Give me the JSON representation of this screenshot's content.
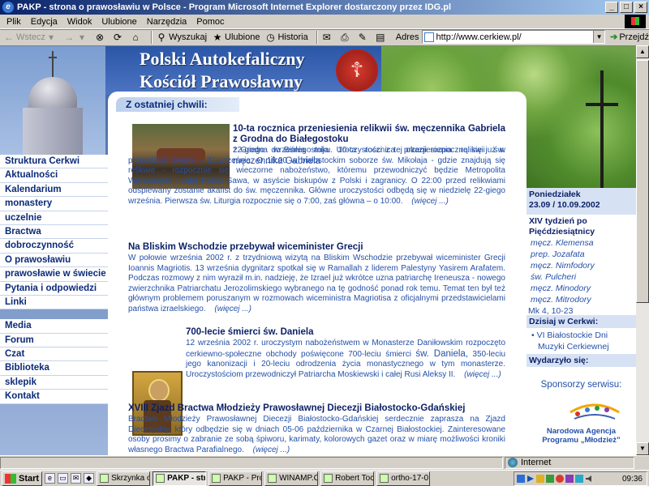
{
  "window": {
    "title": "PAKP - strona o prawosławiu w Polsce - Program Microsoft Internet Explorer dostarczony przez IDG.pl",
    "minimize": "_",
    "maximize": "□",
    "close": "×"
  },
  "menu": [
    "Plik",
    "Edycja",
    "Widok",
    "Ulubione",
    "Narzędzia",
    "Pomoc"
  ],
  "toolbar": {
    "back": "Wstecz",
    "search": "Wyszukaj",
    "favorites": "Ulubione",
    "history": "Historia",
    "address_label": "Adres",
    "address_value": "http://www.cerkiew.pl/",
    "go": "Przejdź"
  },
  "site": {
    "title_line1": "Polski Autokefaliczny",
    "title_line2": "Kościół Prawosławny",
    "emblem": "☦",
    "section_title": "Z ostatniej chwili:"
  },
  "nav": {
    "group1": [
      "Struktura Cerkwi",
      "Aktualności",
      "Kalendarium",
      "monastery",
      "uczelnie",
      "Bractwa",
      "dobroczynność",
      "O prawosławiu",
      "prawosławie w świecie",
      "Pytania i odpowiedzi",
      "Linki"
    ],
    "group2": [
      "Media",
      "Forum",
      "Czat",
      "Biblioteka",
      "sklepik",
      "Kontakt"
    ]
  },
  "articles": [
    {
      "title": "10-ta rocznica przeniesienia relikwii św. męczennika Gabriela z Grodna do Białegostoku",
      "body_a": "22-giego września mija 10-ta rocznica przeniesienia relikwii św.",
      "body_b": "męczennika Gabriela",
      "body_c": "z Grodna do Białegostoku. Uroczystości z tej okazji rozpoczną się już w przeddzień święta – 21-września. O 18:00 w białostockim soborze św. Mikołaja - gdzie znajdują się relikwie - rozpocznie się wieczorne nabożeństwo, któremu przewodniczyć będzie Metropolita Warszawski i całej Polski Sawa, w asyście biskupów z Polski i zagranicy. O 22:00 przed relikwiami odśpiewany zostanie akafist do św. męczennika. Główne uroczystości odbędą się w niedzielę 22-giego września. Pierwsza św. Liturgia rozpocznie się o 7:00, zaś główna – o 10:00.",
      "more": "(więcej ...)"
    },
    {
      "title": "Na Bliskim Wschodzie przebywał wiceminister Grecji",
      "body": "W połowie września 2002 r. z trzydniową wizytą na Bliskim Wschodzie przebywał wiceminister Grecji Ioannis Magriotis. 13 września dygnitarz spotkał się w Ramallah z liderem Palestyny Yasirem Arafatem. Podczas rozmowy z nim wyraził m.in. nadzieję, że Izrael już wkrótce uzna patriarchę Ireneusza - nowego zwierzchnika Patriarchatu Jerozolimskiego wybranego na tę godność ponad rok temu. Temat ten był też głównym problemem poruszanym w rozmowach wiceministra Magriotisa z oficjalnymi przedstawicielami państwa izraelskiego.",
      "more": "(więcej ...)"
    },
    {
      "title": "700-lecie śmierci św. Daniela",
      "body_a": "12 września 2002 r. uroczystym nabożeństwem w Monasterze Daniłowskim rozpoczęto cerkiewno-społeczne obchody poświęcone 700-leciu śmierci",
      "body_b": "św. Daniela,",
      "body_c": "350-leciu jego kanonizacji i 20-leciu odrodzenia życia monastycznego w tym monasterze. Uroczystościom przewodniczył Patriarcha Moskiewski i całej Rusi Aleksy II.",
      "more": "(więcej ...)"
    },
    {
      "title": "XVIII Zjazd Bractwa Młodzieży Prawosławnej Diecezji Białostocko-Gdańskiej",
      "body": "Bractwo Młodzieży Prawosławnej Diecezji Białostocko-Gdańskiej serdecznie zaprasza na Zjazd Diecezjalny, który odbędzie się w dniach 05-06 października w Czarnej Białostockiej. Zainteresowane osoby prosimy o zabranie ze sobą śpiworu, karimaty, kolorowych gazet oraz w miarę możliwości kroniki własnego Bractwa Parafialnego.",
      "more": "(więcej ...)"
    }
  ],
  "right": {
    "date_line1": "Poniedziałek",
    "date_line2": "23.09 / 10.09.2002",
    "week_line1": "XIV tydzień po",
    "week_line2": "Pięćdziesiątnicy",
    "saints": [
      "męcz. Klemensa",
      "prep. Jozafata",
      "męcz. Nimfodory",
      "św. Pulcheri",
      "męcz. Minodory",
      "męcz. Mitrodory"
    ],
    "reading": "Mk 4, 10-23",
    "today_header": "Dzisiaj w Cerkwi:",
    "today_item": "• VI Białostockie Dni Muzyki Cerkiewnej",
    "happened_header": "Wydarzyło się:",
    "sponsors_header": "Sponsorzy serwisu:",
    "sponsor_line1": "Narodowa Agencja",
    "sponsor_line2": "Programu „Młodzież”"
  },
  "status": {
    "zone": "Internet"
  },
  "taskbar": {
    "start": "Start",
    "tasks": [
      "Skrzynka o...",
      "PAKP - str...",
      "PAKP - Pro...",
      "WINAMP.C...",
      "Robert Toc...",
      "ortho-17-0..."
    ],
    "clock": "09:36"
  },
  "colors": {
    "nav_text": "#0b2a78",
    "body_text": "#2450a8",
    "heading_text": "#0b1f66",
    "highlight_bg": "#d6e2f4"
  }
}
